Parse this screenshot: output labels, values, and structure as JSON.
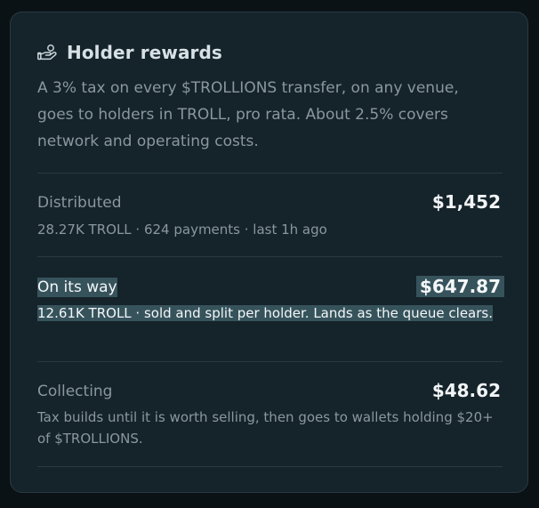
{
  "card": {
    "title": "Holder rewards",
    "icon": "hand-coin-icon",
    "description": "A 3% tax on every $TROLLIONS transfer, on any venue, goes to holders in TROLL, pro rata. About 2.5% covers network and operating costs."
  },
  "rows": [
    {
      "label": "Distributed",
      "amount": "$1,452",
      "detail": "28.27K TROLL · 624 payments · last 1h ago"
    },
    {
      "label": "On its way",
      "amount": "$647.87",
      "detail": "12.61K TROLL · sold and split per holder. Lands as the queue clears."
    },
    {
      "label": "Collecting",
      "amount": "$48.62",
      "detail": "Tax builds until it is worth selling, then goes to wallets holding $20+ of $TROLLIONS."
    }
  ],
  "colors": {
    "background": "#0b1216",
    "card": "#15232a",
    "highlight": "#36535c"
  }
}
